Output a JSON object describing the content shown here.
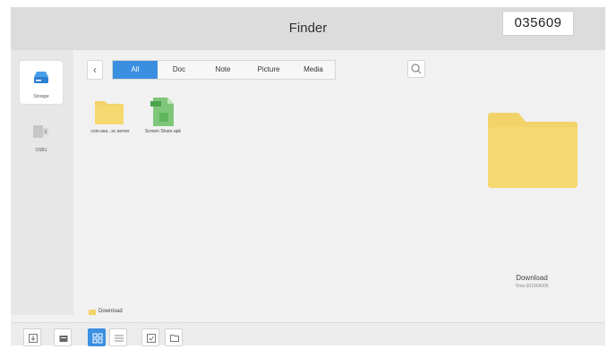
{
  "window": {
    "title": "Finder",
    "code": "035609"
  },
  "sidebar": {
    "items": [
      {
        "label": "Storage",
        "icon": "storage-icon",
        "active": true
      },
      {
        "label": "USB1",
        "icon": "usb-icon",
        "active": false
      }
    ]
  },
  "toolbar": {
    "back_icon": "chevron-left-icon",
    "tabs": [
      {
        "label": "All",
        "active": true
      },
      {
        "label": "Doc",
        "active": false
      },
      {
        "label": "Note",
        "active": false
      },
      {
        "label": "Picture",
        "active": false
      },
      {
        "label": "Media",
        "active": false
      }
    ],
    "search_icon": "search-icon"
  },
  "files": [
    {
      "name": "com.sea...sc.server",
      "type": "folder"
    },
    {
      "name": "Screen Share.apk",
      "type": "apk"
    }
  ],
  "preview": {
    "name": "Download",
    "time": "Time:2019/06/05"
  },
  "path": {
    "label": "Download"
  },
  "bottombar": {
    "buttons": [
      {
        "icon": "import-icon",
        "active": false
      },
      {
        "icon": "storage-box-icon",
        "active": false
      },
      {
        "icon": "grid-view-icon",
        "active": true
      },
      {
        "icon": "list-view-icon",
        "active": false
      },
      {
        "icon": "select-checkbox-icon",
        "active": false
      },
      {
        "icon": "new-folder-icon",
        "active": false
      }
    ]
  },
  "colors": {
    "accent": "#3b8fe0",
    "folder": "#f2d36a",
    "apk": "#7fc67a"
  }
}
